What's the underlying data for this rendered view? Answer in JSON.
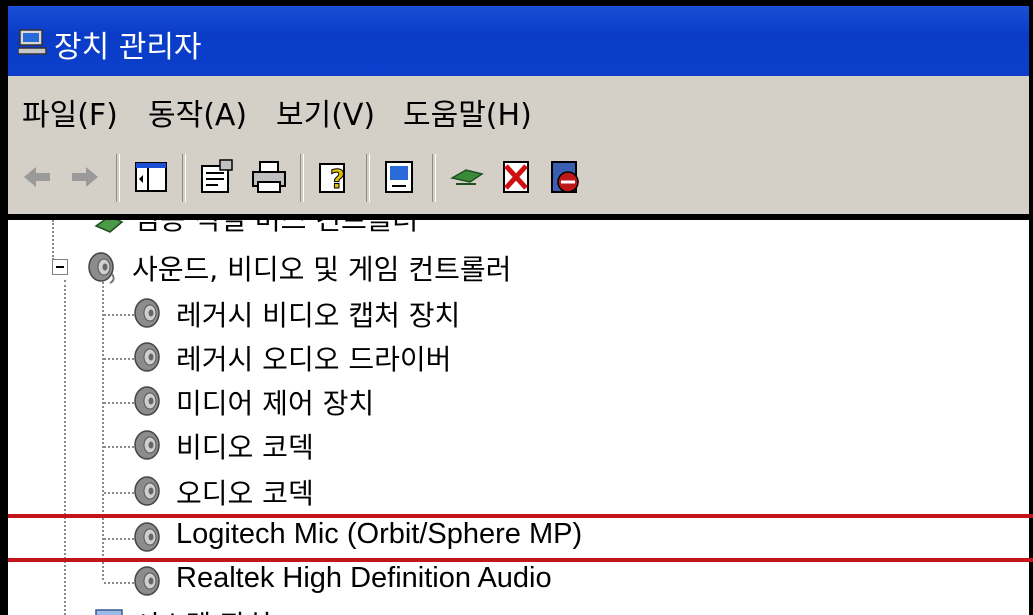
{
  "window": {
    "title": "장치 관리자"
  },
  "menu": [
    {
      "label": "파일(F)"
    },
    {
      "label": "동작(A)"
    },
    {
      "label": "보기(V)"
    },
    {
      "label": "도움말(H)"
    }
  ],
  "toolbar": {
    "icons": [
      "back-arrow-icon",
      "forward-arrow-icon",
      "show-hide-console-tree-icon",
      "properties-icon",
      "print-icon",
      "help-icon",
      "scan-hardware-changes-icon",
      "update-driver-icon",
      "uninstall-icon",
      "disable-icon"
    ]
  },
  "tree": {
    "cut_top_label": "범용 직렬 버스 컨트롤러",
    "category": {
      "label": "사운드, 비디오 및 게임 컨트롤러",
      "expanded": true
    },
    "children": [
      {
        "label": "레거시 비디오 캡처 장치"
      },
      {
        "label": "레거시 오디오 드라이버"
      },
      {
        "label": "미디어 제어 장치"
      },
      {
        "label": "비디오 코덱"
      },
      {
        "label": "오디오 코덱"
      },
      {
        "label": "Logitech Mic (Orbit/Sphere MP)"
      },
      {
        "label": "Realtek High Definition Audio"
      }
    ],
    "cut_bottom_label": "시스템 장치"
  },
  "highlight_color": "#c4151c"
}
